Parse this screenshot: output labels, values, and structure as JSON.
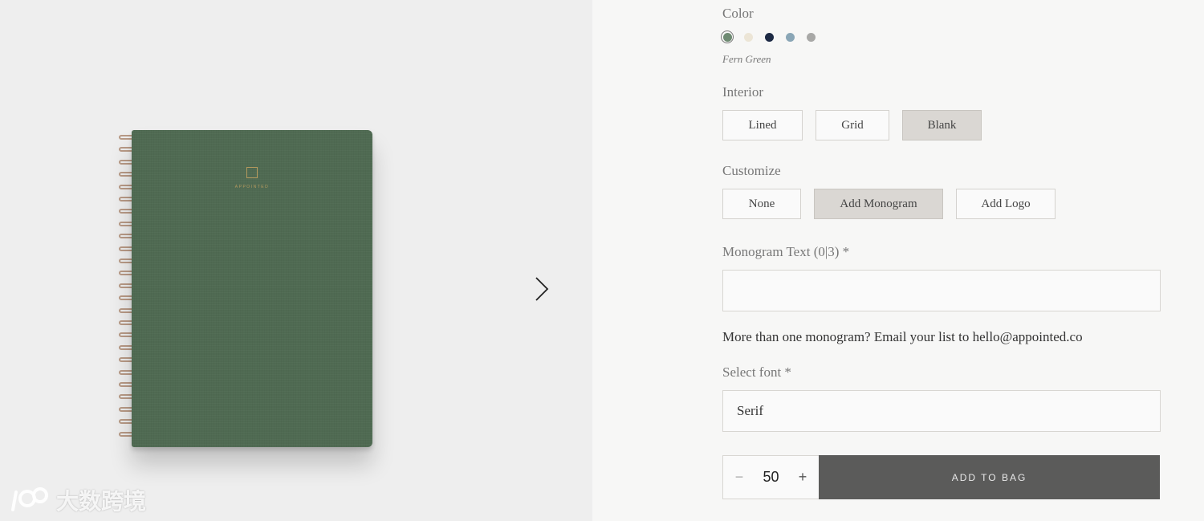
{
  "gallery": {
    "cover_brand": "APPOINTED",
    "next_icon": "chevron-right-icon"
  },
  "watermark": {
    "text": "大数跨境"
  },
  "color": {
    "label": "Color",
    "selected_name": "Fern Green",
    "swatches": [
      {
        "name": "fern-green",
        "hex": "#6e8a72",
        "selected": true
      },
      {
        "name": "cream",
        "hex": "#ece5d6",
        "selected": false
      },
      {
        "name": "navy",
        "hex": "#1d2a44",
        "selected": false
      },
      {
        "name": "sky-blue",
        "hex": "#8aa6b6",
        "selected": false
      },
      {
        "name": "gray",
        "hex": "#a8a8a6",
        "selected": false
      }
    ]
  },
  "interior": {
    "label": "Interior",
    "options": [
      "Lined",
      "Grid",
      "Blank"
    ],
    "selected": "Blank"
  },
  "customize": {
    "label": "Customize",
    "options": [
      "None",
      "Add Monogram",
      "Add Logo"
    ],
    "selected": "Add Monogram"
  },
  "monogram": {
    "label": "Monogram Text (0|3) *",
    "value": ""
  },
  "note": "More than one monogram? Email your list to hello@appointed.co",
  "font": {
    "label": "Select font *",
    "value": "Serif"
  },
  "cart": {
    "quantity": "50",
    "minus": "−",
    "plus": "+",
    "add_label": "ADD TO BAG"
  }
}
